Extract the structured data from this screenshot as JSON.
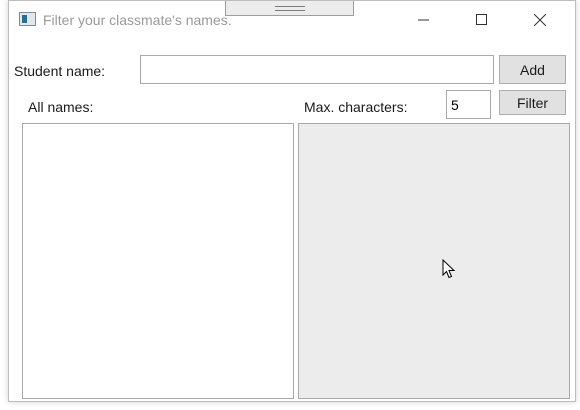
{
  "window": {
    "title": "Filter your classmate's names.",
    "icon": "app-window-icon",
    "controls": {
      "minimize": "minimize-icon",
      "maximize": "maximize-icon",
      "close": "close-icon"
    }
  },
  "form": {
    "student_name_label": "Student name:",
    "student_name_value": "",
    "add_label": "Add",
    "all_names_label": "All names:",
    "max_chars_label": "Max. characters:",
    "max_chars_value": "5",
    "filter_label": "Filter"
  },
  "lists": {
    "all_names": [],
    "filtered_names": []
  },
  "colors": {
    "button_bg": "#e1e1e1",
    "filtered_list_bg": "#ececec",
    "title_text": "#9a9a9a"
  }
}
